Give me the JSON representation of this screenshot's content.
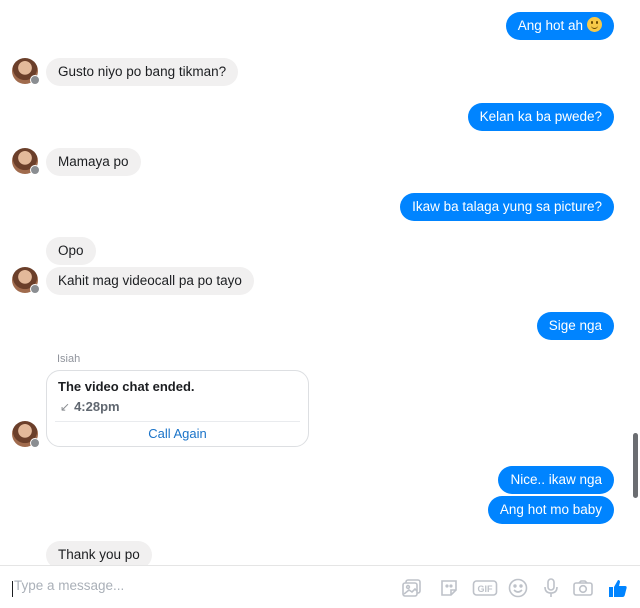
{
  "messages": [
    {
      "side": "out",
      "text": "Ang hot ah"
    },
    {
      "side": "in",
      "text": "Gusto niyo po bang tikman?"
    },
    {
      "side": "out",
      "text": "Kelan ka ba pwede?"
    },
    {
      "side": "in",
      "text": "Mamaya po"
    },
    {
      "side": "out",
      "text": "Ikaw ba talaga yung sa picture?"
    },
    {
      "side": "in",
      "text": "Opo"
    },
    {
      "side": "in",
      "text": "Kahit mag videocall pa po tayo"
    },
    {
      "side": "out",
      "text": "Sige nga"
    },
    {
      "side": "out",
      "text": "Nice.. ikaw nga"
    },
    {
      "side": "out",
      "text": "Ang hot mo baby"
    },
    {
      "side": "in",
      "text": "Thank you po"
    }
  ],
  "video_call": {
    "sender": "Isiah",
    "title": "The video chat ended.",
    "time": "4:28pm",
    "action": "Call Again"
  },
  "composer": {
    "placeholder": "Type a message...",
    "tools": [
      "gallery-icon",
      "sticker-icon",
      "gif-icon",
      "emoji-icon",
      "microphone-icon",
      "camera-icon",
      "like-icon"
    ]
  },
  "colors": {
    "outgoing_bubble": "#0084ff",
    "incoming_bubble": "#f1f0f0",
    "link": "#1a73c8",
    "like": "#0084ff"
  }
}
